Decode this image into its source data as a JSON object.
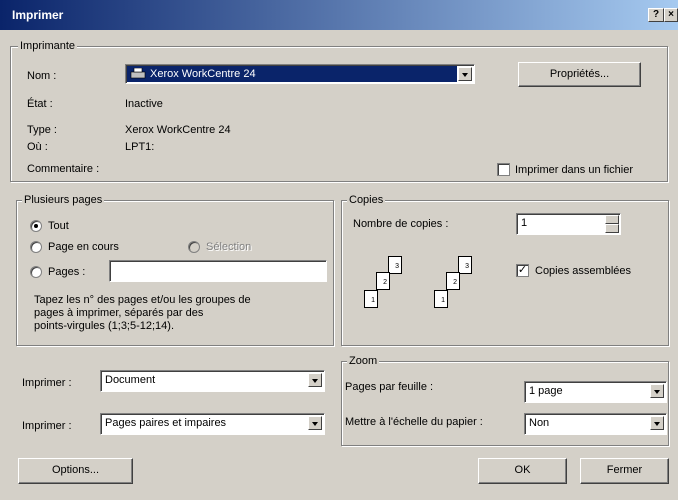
{
  "window": {
    "title": "Imprimer",
    "help_btn": "?",
    "close_btn": "×"
  },
  "printer": {
    "group_label": "Imprimante",
    "name_label": "Nom :",
    "name_value": "Xerox WorkCentre 24",
    "properties_btn": "Propriétés...",
    "status_label": "État :",
    "status_value": "Inactive",
    "type_label": "Type :",
    "type_value": "Xerox WorkCentre 24",
    "where_label": "Où :",
    "where_value": "LPT1:",
    "comment_label": "Commentaire :",
    "print_to_file": "Imprimer dans un fichier",
    "print_to_file_checked": false
  },
  "pages": {
    "group_label": "Plusieurs pages",
    "all": "Tout",
    "current": "Page en cours",
    "selection": "Sélection",
    "pages": "Pages :",
    "pages_value": "",
    "selected": "all",
    "help": [
      "Tapez les n° des pages et/ou les groupes de",
      "pages à imprimer, séparés par des",
      "points-virgules (1;3;5-12;14)."
    ]
  },
  "copies": {
    "group_label": "Copies",
    "count_label": "Nombre de copies :",
    "count_value": "1",
    "collate_label": "Copies assemblées",
    "collate_checked": true,
    "icon_page_labels": [
      "1",
      "2",
      "3"
    ]
  },
  "print_what": {
    "label": "Imprimer :",
    "value": "Document"
  },
  "print_which": {
    "label": "Imprimer :",
    "value": "Pages paires et impaires"
  },
  "zoom": {
    "group_label": "Zoom",
    "pages_per_sheet_label": "Pages par feuille :",
    "pages_per_sheet_value": "1 page",
    "scale_label": "Mettre à l'échelle du papier :",
    "scale_value": "Non"
  },
  "buttons": {
    "options": "Options...",
    "ok": "OK",
    "close": "Fermer"
  },
  "colors": {
    "face": "#d4d0c8",
    "title_start": "#0a246a",
    "title_end": "#a6caf0",
    "selection": "#0a246a"
  }
}
